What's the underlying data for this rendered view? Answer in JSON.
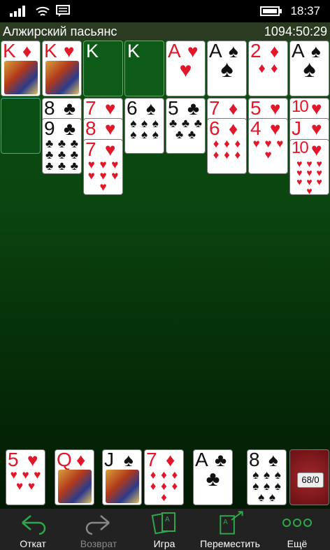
{
  "status": {
    "time": "18:37"
  },
  "game": {
    "title": "Алжирский пасьянс",
    "timer": "1094:50:29"
  },
  "top_row": [
    {
      "rank": "K",
      "suit": "♦",
      "color": "red",
      "type": "face"
    },
    {
      "rank": "K",
      "suit": "♥",
      "color": "red",
      "type": "face"
    },
    {
      "rank": "K",
      "type": "slot"
    },
    {
      "rank": "K",
      "type": "slot"
    },
    {
      "rank": "A",
      "suit": "♥",
      "color": "red",
      "type": "pip",
      "pips": "♥"
    },
    {
      "rank": "A",
      "suit": "♠",
      "color": "black",
      "type": "pip",
      "pips": "♠"
    },
    {
      "rank": "2",
      "suit": "♦",
      "color": "red",
      "type": "pip",
      "pips": "♦ ♦"
    },
    {
      "rank": "A",
      "suit": "♠",
      "color": "black",
      "type": "pip",
      "pips": "♠"
    }
  ],
  "tableau": [
    [],
    [
      {
        "rank": "8",
        "suit": "♣",
        "color": "black"
      },
      {
        "rank": "9",
        "suit": "♣",
        "color": "black",
        "pips": "♣ ♣ ♣ ♣ ♣ ♣ ♣ ♣ ♣"
      }
    ],
    [
      {
        "rank": "7",
        "suit": "♥",
        "color": "red"
      },
      {
        "rank": "8",
        "suit": "♥",
        "color": "red"
      },
      {
        "rank": "7",
        "suit": "♥",
        "color": "red",
        "pips": "♥ ♥ ♥ ♥ ♥ ♥ ♥"
      }
    ],
    [
      {
        "rank": "6",
        "suit": "♠",
        "color": "black",
        "pips": "♠ ♠ ♠ ♠ ♠ ♠"
      }
    ],
    [
      {
        "rank": "5",
        "suit": "♣",
        "color": "black",
        "pips": "♣ ♣ ♣ ♣ ♣"
      }
    ],
    [
      {
        "rank": "7",
        "suit": "♦",
        "color": "red"
      },
      {
        "rank": "6",
        "suit": "♦",
        "color": "red",
        "pips": "♦ ♦ ♦ ♦ ♦ ♦"
      }
    ],
    [
      {
        "rank": "5",
        "suit": "♥",
        "color": "red"
      },
      {
        "rank": "4",
        "suit": "♥",
        "color": "red",
        "pips": "♥ ♥ ♥ ♥"
      }
    ],
    [
      {
        "rank": "10",
        "suit": "♥",
        "color": "red"
      },
      {
        "rank": "J",
        "suit": "♥",
        "color": "red"
      },
      {
        "rank": "10",
        "suit": "♥",
        "color": "red",
        "pips": "♥ ♥ ♥ ♥ ♥ ♥ ♥ ♥ ♥ ♥"
      }
    ]
  ],
  "reserve": [
    {
      "rank": "5",
      "suit": "♥",
      "color": "red",
      "type": "pip",
      "pips": "♥ ♥ ♥ ♥ ♥"
    },
    {
      "rank": "Q",
      "suit": "♦",
      "color": "red",
      "type": "face"
    },
    {
      "rank": "J",
      "suit": "♠",
      "color": "black",
      "type": "face"
    },
    {
      "rank": "7",
      "suit": "♦",
      "color": "red",
      "type": "pip",
      "pips": "♦ ♦ ♦ ♦ ♦ ♦ ♦"
    },
    {
      "rank": "A",
      "suit": "♣",
      "color": "black",
      "type": "pip",
      "pips": "♣"
    },
    {
      "rank": "8",
      "suit": "♠",
      "color": "black",
      "type": "pip",
      "pips": "♠ ♠ ♠ ♠ ♠ ♠ ♠ ♠"
    }
  ],
  "stock": {
    "count": "68/0"
  },
  "appbar": {
    "undo": "Откат",
    "redo": "Возврат",
    "game": "Игра",
    "move": "Переместить",
    "more": "Ещё"
  },
  "colors": {
    "accent": "#2ea84a",
    "table": "#0b5012"
  }
}
